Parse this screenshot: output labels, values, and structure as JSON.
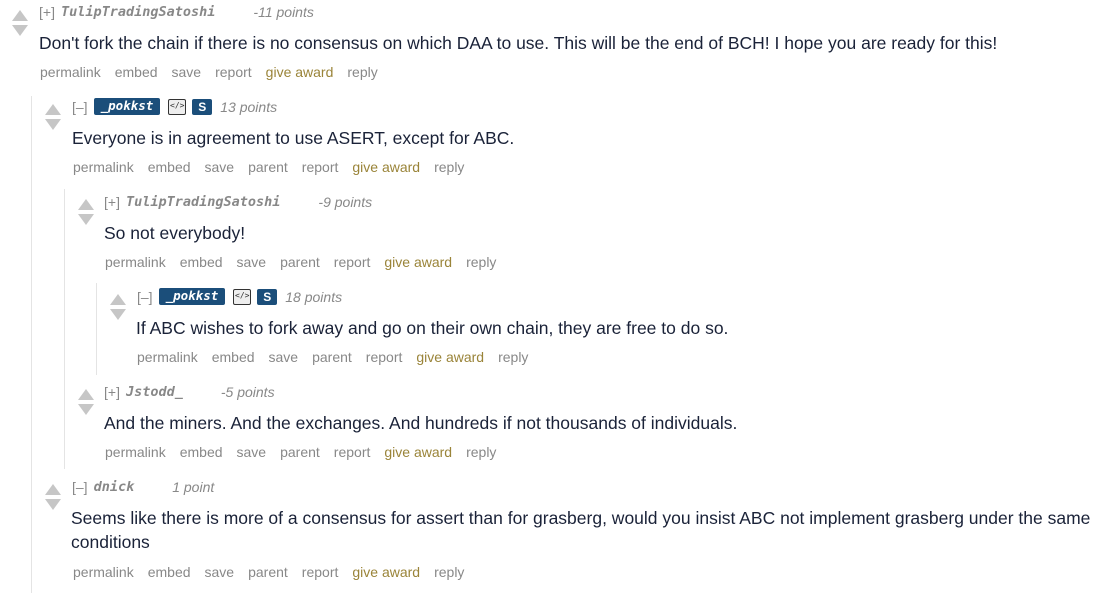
{
  "colors": {
    "flair_bg": "#1b4e7a",
    "award": "#9a8439",
    "meta": "#888888",
    "body": "#1a2238"
  },
  "comments": [
    {
      "expand": "[+]",
      "author": "TulipTradingSatoshi",
      "score": "-11 points",
      "text": "Don't fork the chain if there is no consensus on which DAA to use. This will be the end of BCH! I hope you are ready for this!",
      "buttons": {
        "permalink": "permalink",
        "embed": "embed",
        "save": "save",
        "report": "report",
        "award": "give award",
        "reply": "reply"
      }
    },
    {
      "expand": "[–]",
      "author": "_pokkst",
      "flair_s": "S",
      "score": "13 points",
      "text": "Everyone is in agreement to use ASERT, except for ABC.",
      "buttons": {
        "permalink": "permalink",
        "embed": "embed",
        "save": "save",
        "parent": "parent",
        "report": "report",
        "award": "give award",
        "reply": "reply"
      }
    },
    {
      "expand": "[+]",
      "author": "TulipTradingSatoshi",
      "score": "-9 points",
      "text": "So not everybody!",
      "buttons": {
        "permalink": "permalink",
        "embed": "embed",
        "save": "save",
        "parent": "parent",
        "report": "report",
        "award": "give award",
        "reply": "reply"
      }
    },
    {
      "expand": "[–]",
      "author": "_pokkst",
      "flair_s": "S",
      "score": "18 points",
      "text": "If ABC wishes to fork away and go on their own chain, they are free to do so.",
      "buttons": {
        "permalink": "permalink",
        "embed": "embed",
        "save": "save",
        "parent": "parent",
        "report": "report",
        "award": "give award",
        "reply": "reply"
      }
    },
    {
      "expand": "[+]",
      "author": "Jstodd_",
      "score": "-5 points",
      "text": "And the miners. And the exchanges. And hundreds if not thousands of individuals.",
      "buttons": {
        "permalink": "permalink",
        "embed": "embed",
        "save": "save",
        "parent": "parent",
        "report": "report",
        "award": "give award",
        "reply": "reply"
      }
    },
    {
      "expand": "[–]",
      "author": "dnick",
      "score": "1 point",
      "text": "Seems like there is more of a consensus for assert than for grasberg, would you insist ABC not implement grasberg under the same conditions",
      "buttons": {
        "permalink": "permalink",
        "embed": "embed",
        "save": "save",
        "parent": "parent",
        "report": "report",
        "award": "give award",
        "reply": "reply"
      }
    }
  ]
}
